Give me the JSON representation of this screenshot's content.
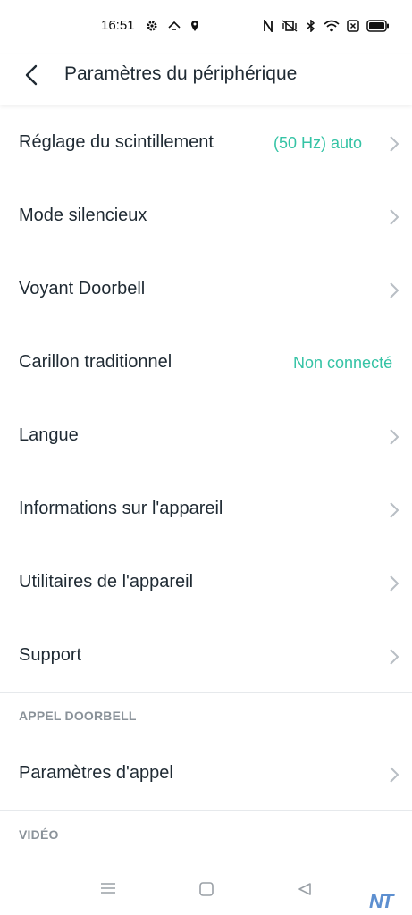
{
  "status_bar": {
    "time": "16:51"
  },
  "header": {
    "title": "Paramètres du périphérique"
  },
  "settings": [
    {
      "label": "Réglage du scintillement",
      "value": "(50 Hz) auto",
      "chevron": true
    },
    {
      "label": "Mode silencieux",
      "value": "",
      "chevron": true
    },
    {
      "label": "Voyant Doorbell",
      "value": "",
      "chevron": true
    },
    {
      "label": "Carillon traditionnel",
      "value": "Non connecté",
      "chevron": false
    },
    {
      "label": "Langue",
      "value": "",
      "chevron": true
    },
    {
      "label": "Informations sur l'appareil",
      "value": "",
      "chevron": true
    },
    {
      "label": "Utilitaires de l'appareil",
      "value": "",
      "chevron": true
    },
    {
      "label": "Support",
      "value": "",
      "chevron": true
    }
  ],
  "sections": [
    {
      "header": "APPEL DOORBELL",
      "items": [
        {
          "label": "Paramètres d'appel",
          "chevron": true
        }
      ]
    },
    {
      "header": "VIDÉO",
      "items": []
    }
  ],
  "watermark": "NT",
  "colors": {
    "accent": "#35c3a5",
    "text": "#1f2a33",
    "section": "#8a9299",
    "chevron": "#b8bec4"
  }
}
